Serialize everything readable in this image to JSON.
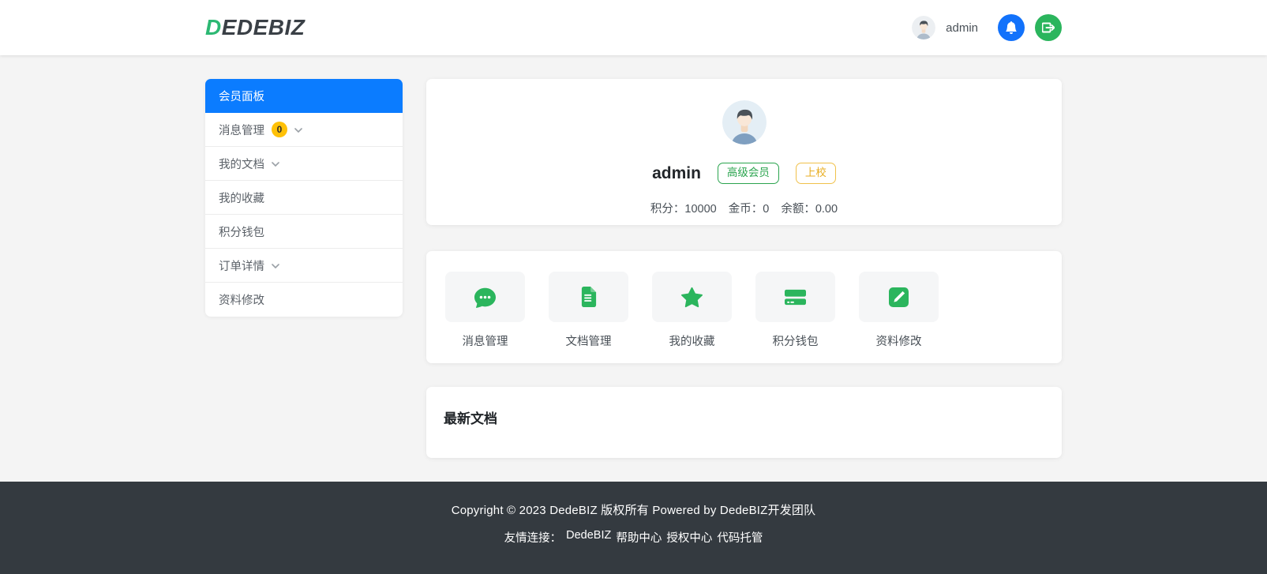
{
  "header": {
    "logo_first": "D",
    "logo_rest": "EDEBIZ",
    "username": "admin",
    "icons": {
      "notifications": "bell-icon",
      "logout": "box-arrow-right-icon"
    }
  },
  "sidebar": {
    "items": [
      {
        "label": "会员面板",
        "active": true
      },
      {
        "label": "消息管理",
        "badge": "0",
        "chevron": true
      },
      {
        "label": "我的文档",
        "chevron": true
      },
      {
        "label": "我的收藏"
      },
      {
        "label": "积分钱包"
      },
      {
        "label": "订单详情",
        "chevron": true
      },
      {
        "label": "资料修改"
      }
    ]
  },
  "profile": {
    "username": "admin",
    "member_badge": "高级会员",
    "rank_badge": "上校",
    "stats": [
      {
        "label": "积分：",
        "value": "10000"
      },
      {
        "label": "金币：",
        "value": "0"
      },
      {
        "label": "余额：",
        "value": "0.00"
      }
    ]
  },
  "shortcuts": [
    {
      "label": "消息管理",
      "icon": "chat-dots-icon"
    },
    {
      "label": "文档管理",
      "icon": "document-icon"
    },
    {
      "label": "我的收藏",
      "icon": "star-icon"
    },
    {
      "label": "积分钱包",
      "icon": "credit-card-icon"
    },
    {
      "label": "资料修改",
      "icon": "pencil-square-icon"
    }
  ],
  "latest_docs": {
    "title": "最新文档"
  },
  "footer": {
    "copyright": "Copyright © 2023 DedeBIZ 版权所有 Powered by DedeBIZ开发团队",
    "links_label": "友情连接：",
    "links": [
      "DedeBIZ",
      "帮助中心",
      "授权中心",
      "代码托管"
    ]
  },
  "colors": {
    "primary_blue": "#0b7cff",
    "success_green": "#2bb55d",
    "brand_green": "#2cb873",
    "warning_amber": "#ffc107",
    "footer_bg": "#343a40",
    "page_bg": "#f4f4f4"
  }
}
